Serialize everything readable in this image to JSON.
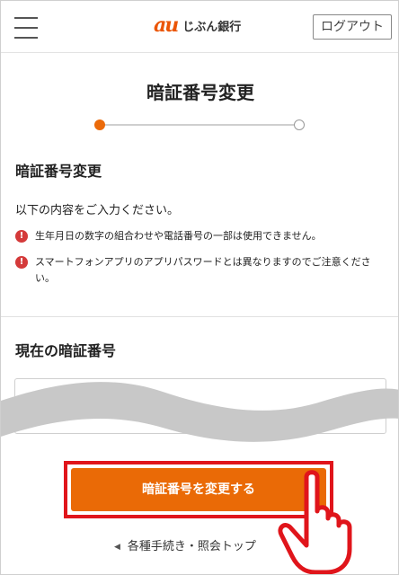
{
  "header": {
    "logo_mark": "au",
    "logo_text": "じぶん銀行",
    "logout_label": "ログアウト"
  },
  "page": {
    "title": "暗証番号変更",
    "progress": {
      "current_step": 1,
      "total_steps": 2
    }
  },
  "form": {
    "section_title": "暗証番号変更",
    "instruction": "以下の内容をご入力ください。",
    "notes": [
      "生年月日の数字の組合わせや電話番号の一部は使用できません。",
      "スマートフォンアプリのアプリパスワードとは異なりますのでご注意ください。"
    ],
    "current_pin_label": "現在の暗証番号",
    "current_pin_value": ""
  },
  "actions": {
    "submit_label": "暗証番号を変更する",
    "back_label": "各種手続き・照会トップ"
  },
  "colors": {
    "accent": "#ea6a06",
    "highlight_frame": "#e0151b",
    "warning_icon": "#d43a3a",
    "logo": "#eb5505"
  },
  "icons": {
    "menu": "hamburger-menu-icon",
    "warning": "exclamation-circle-icon",
    "back": "triangle-left-icon",
    "pointer": "pointing-hand-icon"
  }
}
